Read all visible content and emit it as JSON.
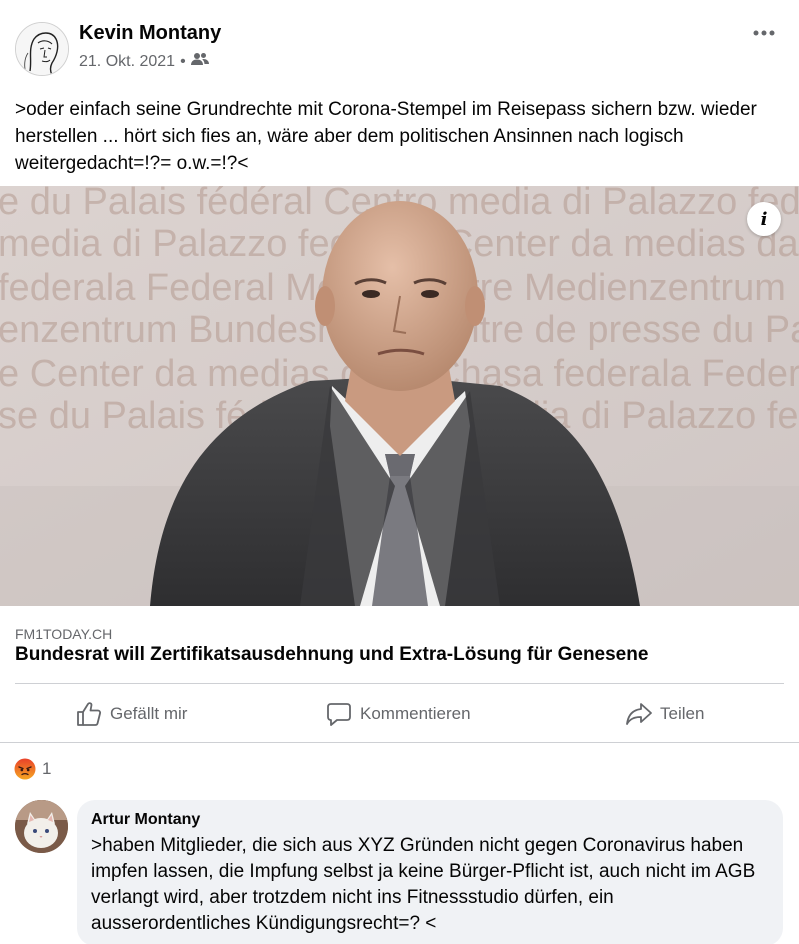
{
  "post": {
    "author": "Kevin Montany",
    "date": "21. Okt. 2021",
    "separator": "•",
    "audience_icon": "friends-icon",
    "more_icon": "more-options-icon",
    "text": ">oder einfach seine Grundrechte mit  Corona-Stempel im Reisepass sichern bzw. wieder herstellen   ... hört sich fies an, wäre aber dem politischen Ansinnen nach logisch weitergedacht=!?= o.w.=!?<"
  },
  "link": {
    "backdrop_text": "Centre media di Palazzo federale Medienzentrum Bundeshaus Centre de presse du Palais fédéral Center da medias da la Chasa federala Federal Media Centre",
    "info_icon": "info-icon",
    "info_label": "i",
    "domain": "FM1TODAY.CH",
    "title": "Bundesrat will Zertifikatsausdehnung und Extra-Lösung für Genesene"
  },
  "actions": {
    "like_label": "Gefällt mir",
    "comment_label": "Kommentieren",
    "share_label": "Teilen"
  },
  "reactions": {
    "type": "angry",
    "count": "1"
  },
  "comment": {
    "author": "Artur Montany",
    "text": ">haben Mitglieder, die sich aus XYZ Gründen nicht gegen Coronavirus haben impfen lassen, die Impfung selbst ja keine Bürger-Pflicht ist,  auch nicht im AGB verlangt wird, aber trotzdem nicht ins Fitnessstudio dürfen, ein ausserordentliches Kündigungsrecht=? <"
  },
  "colors": {
    "text_primary": "#050505",
    "text_secondary": "#65676b",
    "comment_bubble": "#f0f2f5",
    "divider": "#ced0d4",
    "angry_reaction": "#f0743d"
  }
}
